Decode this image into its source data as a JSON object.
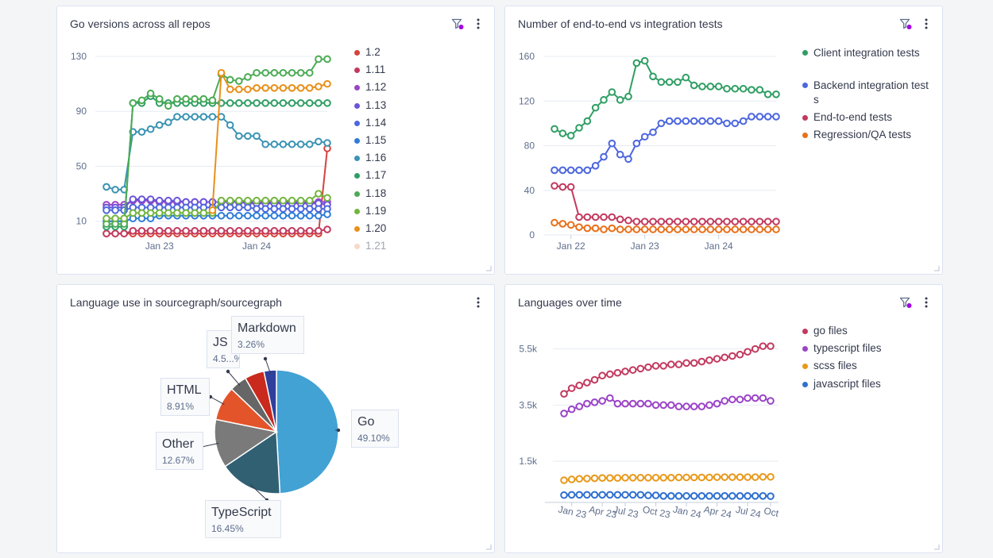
{
  "cards": {
    "go_versions": {
      "title": "Go versions across all repos"
    },
    "tests": {
      "title": "Number of end-to-end vs integration tests"
    },
    "language_use": {
      "title": "Language use in sourcegraph/sourcegraph"
    },
    "languages_over_time": {
      "title": "Languages over time"
    }
  },
  "icons": {
    "filter": "filter-icon",
    "menu": "kebab-menu-icon",
    "resize": "resize-handle-icon"
  },
  "colors": {
    "filter_badge": "#a305e1",
    "grid": "#e6ebf2",
    "axis_text": "#5e6e8c"
  },
  "chart_data": [
    {
      "type": "line",
      "title": "Go versions across all repos",
      "x_ticks": [
        "Jan 23",
        "Jan 24"
      ],
      "y_ticks": [
        "10",
        "50",
        "90",
        "130"
      ],
      "ylim": [
        0,
        130
      ],
      "points": 26,
      "series": [
        {
          "name": "1.2",
          "color": "#d6423c",
          "values": [
            1,
            1,
            1,
            1,
            1,
            1,
            1,
            1,
            1,
            1,
            1,
            1,
            1,
            1,
            1,
            1,
            1,
            1,
            1,
            1,
            1,
            1,
            1,
            1,
            1,
            63
          ]
        },
        {
          "name": "1.11",
          "color": "#c23a5f",
          "values": [
            1,
            1,
            1,
            3,
            3,
            3,
            3,
            3,
            3,
            3,
            3,
            3,
            3,
            3,
            3,
            3,
            3,
            3,
            3,
            3,
            3,
            3,
            3,
            3,
            3,
            4
          ]
        },
        {
          "name": "1.12",
          "color": "#9b44c7",
          "values": [
            22,
            22,
            22,
            25,
            25,
            25,
            24,
            24,
            24,
            24,
            24,
            24,
            24,
            24,
            24,
            24,
            24,
            24,
            24,
            24,
            24,
            24,
            24,
            24,
            24,
            24
          ]
        },
        {
          "name": "1.13",
          "color": "#6a55d8",
          "values": [
            20,
            20,
            20,
            26,
            26,
            26,
            25,
            25,
            25,
            24,
            24,
            24,
            24,
            24,
            24,
            24,
            23,
            23,
            23,
            23,
            23,
            23,
            23,
            23,
            23,
            22
          ]
        },
        {
          "name": "1.14",
          "color": "#4d67de",
          "values": [
            18,
            18,
            18,
            20,
            20,
            20,
            20,
            20,
            20,
            20,
            20,
            20,
            20,
            20,
            20,
            20,
            20,
            19,
            19,
            19,
            19,
            19,
            19,
            19,
            19,
            19
          ]
        },
        {
          "name": "1.15",
          "color": "#2d7cd8",
          "values": [
            10,
            10,
            10,
            12,
            12,
            12,
            14,
            14,
            14,
            14,
            14,
            14,
            14,
            14,
            14,
            14,
            14,
            14,
            14,
            14,
            14,
            14,
            14,
            14,
            14,
            15
          ]
        },
        {
          "name": "1.16",
          "color": "#3a93b3",
          "values": [
            35,
            33,
            33,
            75,
            75,
            77,
            80,
            82,
            86,
            86,
            86,
            86,
            86,
            86,
            80,
            72,
            72,
            72,
            66,
            66,
            66,
            66,
            66,
            66,
            68,
            67
          ]
        },
        {
          "name": "1.17",
          "color": "#2f9e64",
          "values": [
            6,
            6,
            6,
            96,
            96,
            101,
            96,
            96,
            96,
            96,
            96,
            96,
            96,
            96,
            96,
            96,
            96,
            96,
            96,
            96,
            96,
            96,
            96,
            96,
            96,
            96
          ]
        },
        {
          "name": "1.18",
          "color": "#4bab55",
          "values": [
            8,
            8,
            8,
            96,
            98,
            103,
            99,
            94,
            99,
            99,
            99,
            99,
            98,
            117,
            113,
            112,
            115,
            118,
            118,
            118,
            118,
            118,
            118,
            118,
            128,
            128
          ]
        },
        {
          "name": "1.19",
          "color": "#72b53e",
          "values": [
            12,
            12,
            12,
            16,
            16,
            16,
            16,
            16,
            16,
            16,
            16,
            16,
            16,
            25,
            25,
            25,
            25,
            25,
            25,
            25,
            25,
            25,
            25,
            25,
            30,
            27
          ]
        },
        {
          "name": "1.20",
          "color": "#e8901a",
          "values": [
            null,
            null,
            null,
            null,
            null,
            null,
            null,
            null,
            null,
            null,
            null,
            null,
            18,
            118,
            106,
            106,
            106,
            107,
            107,
            107,
            107,
            107,
            107,
            107,
            108,
            110
          ]
        },
        {
          "name": "1.21",
          "color": "#f1a987",
          "values": []
        }
      ]
    },
    {
      "type": "line",
      "title": "Number of end-to-end vs integration tests",
      "x_ticks": [
        "Jan 22",
        "Jan 23",
        "Jan 24"
      ],
      "y_ticks": [
        "0",
        "40",
        "80",
        "120",
        "160"
      ],
      "ylim": [
        0,
        160
      ],
      "points": 28,
      "series": [
        {
          "name": "Client integration tests",
          "color": "#2f9e64",
          "values": [
            95,
            91,
            89,
            96,
            102,
            114,
            121,
            128,
            121,
            124,
            154,
            156,
            142,
            137,
            137,
            137,
            141,
            134,
            133,
            133,
            133,
            131,
            131,
            131,
            130,
            130,
            126,
            126
          ]
        },
        {
          "name": "Backend integration tests",
          "color": "#4d67de",
          "values": [
            58,
            58,
            58,
            58,
            58,
            62,
            70,
            82,
            72,
            68,
            82,
            88,
            92,
            100,
            102,
            102,
            102,
            102,
            102,
            102,
            102,
            100,
            100,
            102,
            106,
            106,
            106,
            106
          ]
        },
        {
          "name": "End-to-end tests",
          "color": "#c23a5f",
          "values": [
            44,
            43,
            43,
            16,
            16,
            16,
            16,
            16,
            14,
            13,
            12,
            12,
            12,
            12,
            12,
            12,
            12,
            12,
            12,
            12,
            12,
            12,
            12,
            12,
            12,
            12,
            12,
            12
          ]
        },
        {
          "name": "Regression/QA tests",
          "color": "#e8701a",
          "values": [
            11,
            10,
            9,
            7,
            6,
            6,
            5,
            6,
            5,
            5,
            5,
            5,
            5,
            5,
            5,
            5,
            5,
            5,
            5,
            5,
            5,
            5,
            5,
            5,
            5,
            5,
            5,
            5
          ]
        }
      ]
    },
    {
      "type": "pie",
      "title": "Language use in sourcegraph/sourcegraph",
      "slices": [
        {
          "name": "Go",
          "percent": "49.10%",
          "value": 49.1,
          "color": "#42a2d4"
        },
        {
          "name": "TypeScript",
          "percent": "16.45%",
          "value": 16.45,
          "color": "#316073"
        },
        {
          "name": "Other",
          "percent": "12.67%",
          "value": 12.67,
          "color": "#7a7a7a"
        },
        {
          "name": "HTML",
          "percent": "8.91%",
          "value": 8.91,
          "color": "#e4542a"
        },
        {
          "name": "JS",
          "percent": "4.5...%",
          "value": 4.51,
          "color": "#666666"
        },
        {
          "name": "",
          "percent": "",
          "value": 5.1,
          "color": "#c92a1d"
        },
        {
          "name": "Markdown",
          "percent": "3.26%",
          "value": 3.26,
          "color": "#2e3f9c"
        }
      ]
    },
    {
      "type": "line",
      "title": "Languages over time",
      "x_ticks": [
        "Jan 23",
        "Apr 23",
        "Jul 23",
        "Oct 23",
        "Jan 24",
        "Apr 24",
        "Jul 24",
        "Oct"
      ],
      "y_ticks": [
        "1.5k",
        "3.5k",
        "5.5k"
      ],
      "ylim": [
        0,
        6000
      ],
      "points": 28,
      "series": [
        {
          "name": "go files",
          "color": "#c23a5f",
          "values": [
            3900,
            4100,
            4200,
            4300,
            4400,
            4550,
            4600,
            4650,
            4700,
            4750,
            4800,
            4850,
            4900,
            4900,
            4950,
            4950,
            5000,
            5000,
            5050,
            5100,
            5150,
            5200,
            5250,
            5300,
            5400,
            5500,
            5600,
            5600
          ]
        },
        {
          "name": "typescript files",
          "color": "#9b44c7",
          "values": [
            3200,
            3350,
            3450,
            3550,
            3600,
            3650,
            3750,
            3550,
            3550,
            3550,
            3550,
            3550,
            3500,
            3500,
            3500,
            3450,
            3450,
            3450,
            3450,
            3500,
            3550,
            3650,
            3700,
            3700,
            3750,
            3750,
            3750,
            3650
          ]
        },
        {
          "name": "scss files",
          "color": "#e8981a",
          "values": [
            820,
            850,
            870,
            880,
            890,
            900,
            900,
            900,
            910,
            910,
            910,
            910,
            910,
            910,
            910,
            920,
            920,
            920,
            920,
            920,
            930,
            930,
            930,
            930,
            930,
            930,
            940,
            940
          ]
        },
        {
          "name": "javascript files",
          "color": "#2d6fd0",
          "values": [
            290,
            300,
            300,
            300,
            300,
            300,
            300,
            300,
            300,
            300,
            300,
            280,
            280,
            260,
            260,
            260,
            260,
            260,
            260,
            260,
            260,
            260,
            260,
            260,
            260,
            260,
            260,
            250
          ]
        }
      ]
    }
  ]
}
